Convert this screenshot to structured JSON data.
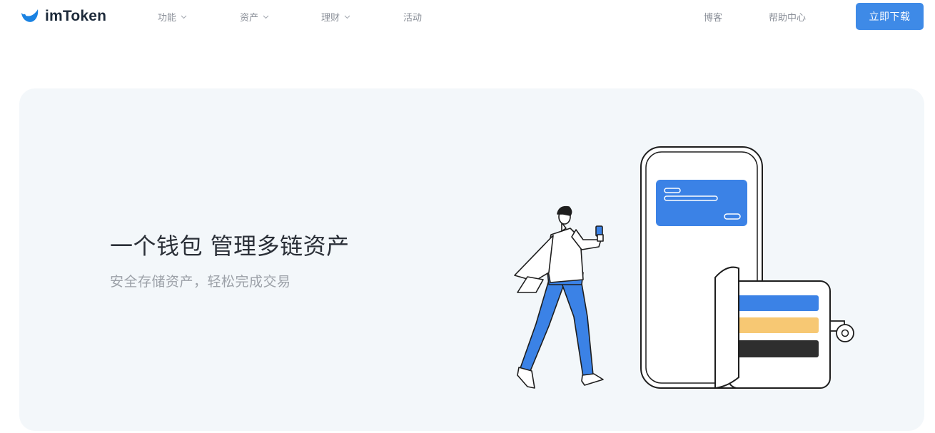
{
  "header": {
    "logo_text": "imToken",
    "nav_left": [
      {
        "label": "功能",
        "has_dropdown": true
      },
      {
        "label": "资产",
        "has_dropdown": true
      },
      {
        "label": "理财",
        "has_dropdown": true
      },
      {
        "label": "活动",
        "has_dropdown": false
      }
    ],
    "nav_right": [
      {
        "label": "博客"
      },
      {
        "label": "帮助中心"
      }
    ],
    "download_label": "立即下载"
  },
  "hero": {
    "title": "一个钱包 管理多链资产",
    "subtitle": "安全存储资产，轻松完成交易"
  },
  "colors": {
    "brand_blue": "#3e8ae7",
    "hero_background": "#f3f7fa",
    "card_yellow": "#f7c873",
    "card_dark": "#2e2e2e"
  },
  "icons": {
    "logo": "imtoken-logo-icon",
    "dropdown": "chevron-down-icon"
  }
}
